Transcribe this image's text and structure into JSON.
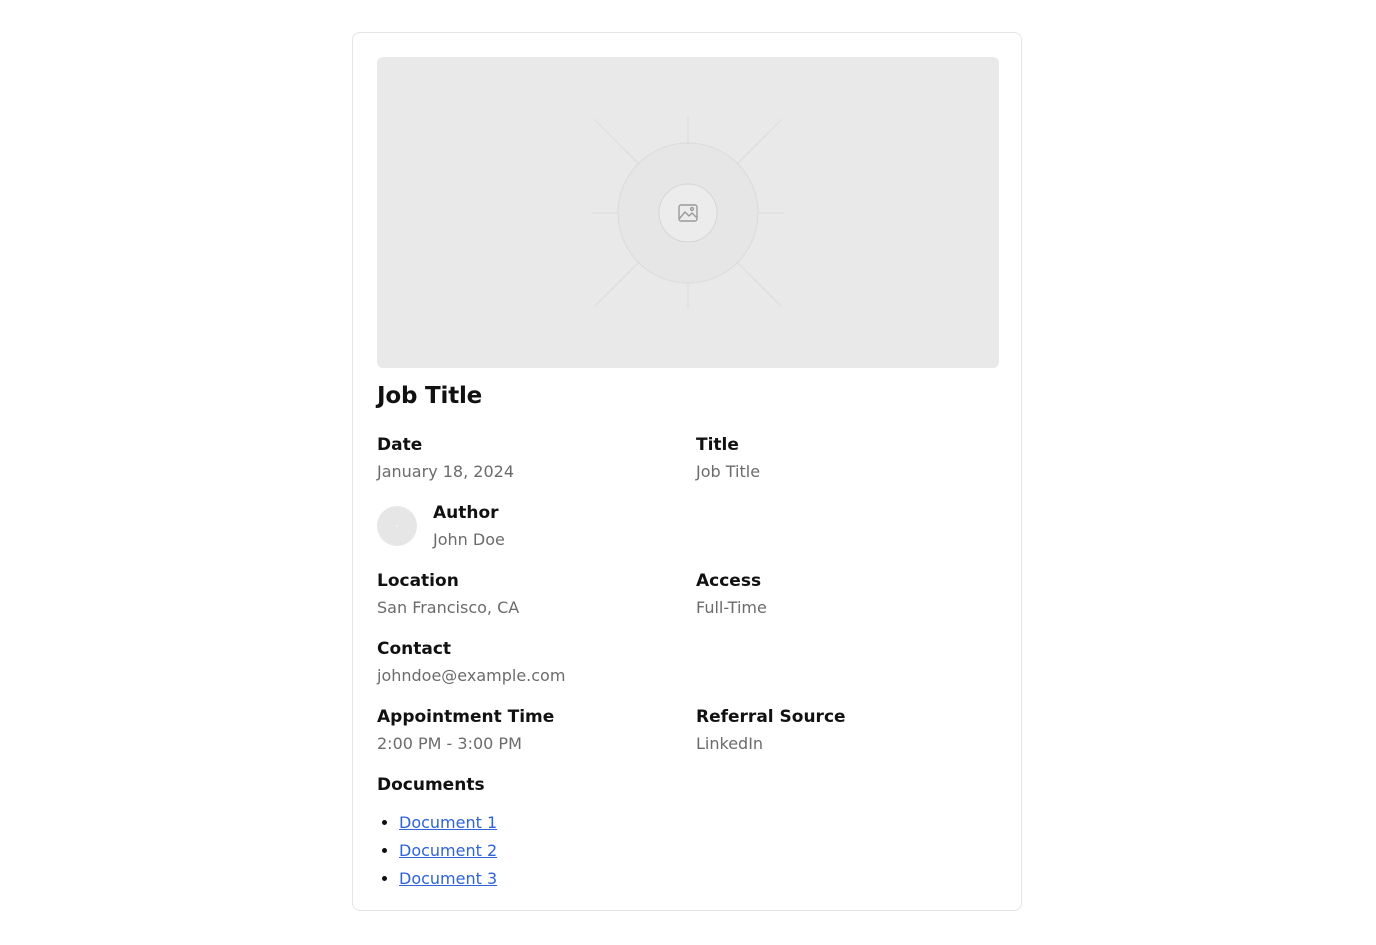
{
  "card": {
    "heading": "Job Title",
    "image": {
      "icon": "image-placeholder-icon"
    }
  },
  "fields": {
    "date": {
      "label": "Date",
      "value": "January 18, 2024"
    },
    "title": {
      "label": "Title",
      "value": "Job Title"
    },
    "author": {
      "label": "Author",
      "value": "John Doe"
    },
    "location": {
      "label": "Location",
      "value": "San Francisco, CA"
    },
    "access": {
      "label": "Access",
      "value": "Full-Time"
    },
    "contact": {
      "label": "Contact",
      "value": "johndoe@example.com"
    },
    "appointment_time": {
      "label": "Appointment Time",
      "value": "2:00 PM - 3:00 PM"
    },
    "referral_source": {
      "label": "Referral Source",
      "value": "LinkedIn"
    }
  },
  "documents": {
    "label": "Documents",
    "items": [
      "Document 1",
      "Document 2",
      "Document 3"
    ]
  },
  "colors": {
    "link": "#2f63d8",
    "muted_text": "#6b6b6b",
    "placeholder_bg": "#e9e9e9"
  }
}
